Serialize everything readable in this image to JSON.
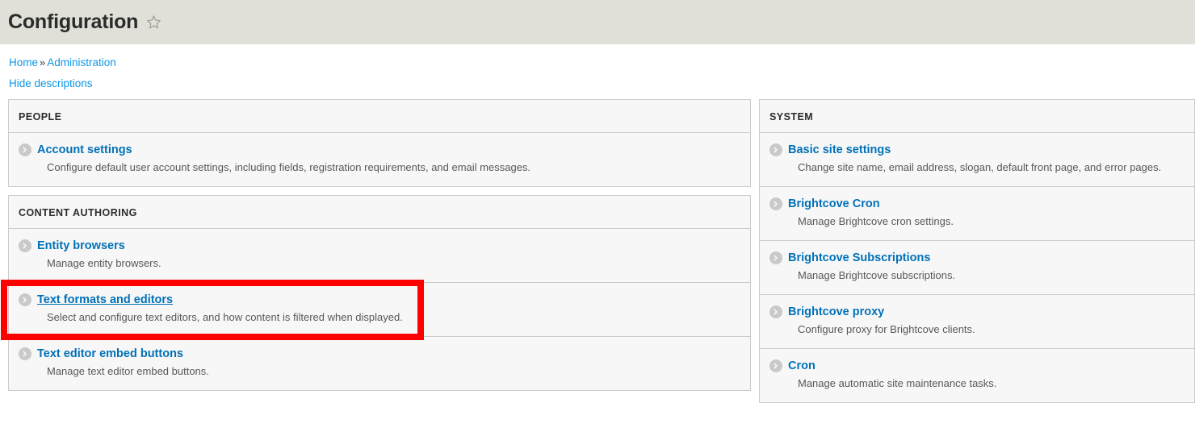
{
  "header": {
    "title": "Configuration",
    "star_icon": "star-outline-icon"
  },
  "breadcrumb": {
    "items": [
      "Home",
      "Administration"
    ],
    "separator": "»"
  },
  "actions": {
    "hide_descriptions": "Hide descriptions"
  },
  "colors": {
    "header_band": "#e0e0d8",
    "link_blue": "#0071b8",
    "breadcrumb_blue": "#0f96e6",
    "panel_bg": "#f7f7f7",
    "panel_border": "#cccccc",
    "highlight": "#ff0000",
    "description_text": "#58585a"
  },
  "left_column": [
    {
      "title": "PEOPLE",
      "items": [
        {
          "label": "Account settings",
          "description": "Configure default user account settings, including fields, registration requirements, and email messages.",
          "icon": "chevron-right-circle-icon",
          "highlighted": false,
          "hovered": false
        }
      ]
    },
    {
      "title": "CONTENT AUTHORING",
      "items": [
        {
          "label": "Entity browsers",
          "description": "Manage entity browsers.",
          "icon": "chevron-right-circle-icon",
          "highlighted": false,
          "hovered": false
        },
        {
          "label": "Text formats and editors",
          "description": "Select and configure text editors, and how content is filtered when displayed.",
          "icon": "chevron-right-circle-icon",
          "highlighted": true,
          "hovered": true
        },
        {
          "label": "Text editor embed buttons",
          "description": "Manage text editor embed buttons.",
          "icon": "chevron-right-circle-icon",
          "highlighted": false,
          "hovered": false
        }
      ]
    }
  ],
  "right_column": [
    {
      "title": "SYSTEM",
      "items": [
        {
          "label": "Basic site settings",
          "description": "Change site name, email address, slogan, default front page, and error pages.",
          "icon": "chevron-right-circle-icon",
          "highlighted": false,
          "hovered": false
        },
        {
          "label": "Brightcove Cron",
          "description": "Manage Brightcove cron settings.",
          "icon": "chevron-right-circle-icon",
          "highlighted": false,
          "hovered": false
        },
        {
          "label": "Brightcove Subscriptions",
          "description": "Manage Brightcove subscriptions.",
          "icon": "chevron-right-circle-icon",
          "highlighted": false,
          "hovered": false
        },
        {
          "label": "Brightcove proxy",
          "description": "Configure proxy for Brightcove clients.",
          "icon": "chevron-right-circle-icon",
          "highlighted": false,
          "hovered": false
        },
        {
          "label": "Cron",
          "description": "Manage automatic site maintenance tasks.",
          "icon": "chevron-right-circle-icon",
          "highlighted": false,
          "hovered": false
        }
      ]
    }
  ]
}
